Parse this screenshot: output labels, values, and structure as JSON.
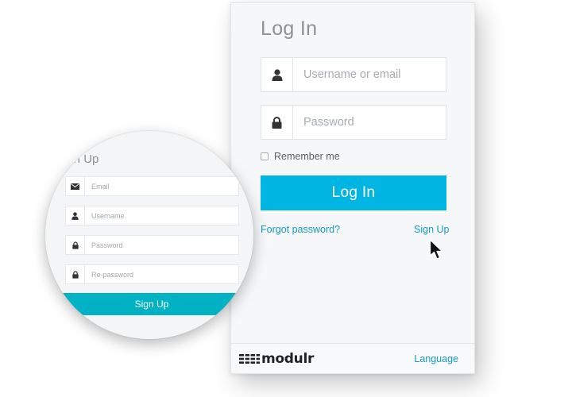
{
  "login": {
    "title": "Log In",
    "username_placeholder": "Username or email",
    "password_placeholder": "Password",
    "remember_label": "Remember me",
    "login_button": "Log In",
    "forgot_password": "Forgot password?",
    "sign_up": "Sign Up"
  },
  "footer": {
    "logo_text": "modulr",
    "language": "Language"
  },
  "signup_zoom": {
    "title": "Sign Up",
    "email_placeholder": "Email",
    "username_placeholder": "Username",
    "password_placeholder": "Password",
    "repassword_placeholder": "Re-password",
    "signup_button": "Sign Up"
  },
  "icons": {
    "user": "user-icon",
    "lock": "lock-icon",
    "email": "envelope-icon",
    "cursor": "mouse-pointer-icon"
  },
  "colors": {
    "primary_button": "#00b5e2",
    "signup_button": "#00b2c4",
    "link": "#169ac6",
    "panel_bg": "#f6f7f8",
    "title_text": "#8c9196",
    "placeholder_text": "#a7abb0"
  }
}
